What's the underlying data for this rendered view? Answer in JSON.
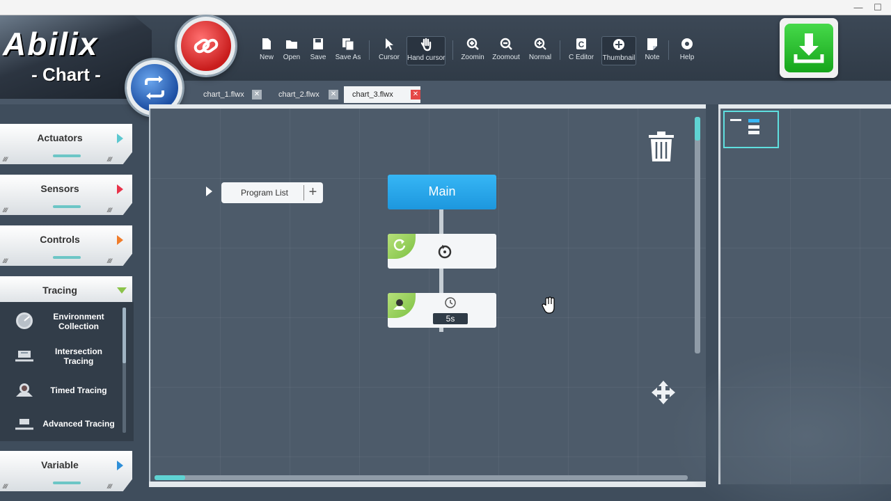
{
  "window": {
    "minimize": "—",
    "maximize": "☐"
  },
  "logo": {
    "top": "Abilix",
    "bottom": "- Chart -"
  },
  "toolbar": {
    "tools": [
      {
        "id": "new",
        "label": "New"
      },
      {
        "id": "open",
        "label": "Open"
      },
      {
        "id": "save",
        "label": "Save"
      },
      {
        "id": "save_as",
        "label": "Save As"
      },
      {
        "id": "cursor",
        "label": "Cursor"
      },
      {
        "id": "hand_cursor",
        "label": "Hand cursor",
        "active": true
      },
      {
        "id": "zoomin",
        "label": "Zoomin"
      },
      {
        "id": "zoomout",
        "label": "Zoomout"
      },
      {
        "id": "normal",
        "label": "Normal"
      },
      {
        "id": "c_editor",
        "label": "C Editor"
      },
      {
        "id": "thumbnail",
        "label": "Thumbnail",
        "active": true
      },
      {
        "id": "note",
        "label": "Note"
      },
      {
        "id": "help",
        "label": "Help"
      }
    ]
  },
  "tabs": [
    {
      "label": "chart_1.flwx",
      "close": "✕"
    },
    {
      "label": "chart_2.flwx",
      "close": "✕"
    },
    {
      "label": "chart_3.flwx",
      "close": "✕",
      "active": true
    }
  ],
  "sidebar": {
    "categories": [
      {
        "label": "Actuators",
        "arrow_color": "#5cc8d0"
      },
      {
        "label": "Sensors",
        "arrow_color": "#e8334a"
      },
      {
        "label": "Controls",
        "arrow_color": "#f07c2a"
      },
      {
        "label": "Tracing",
        "arrow_color": "#8bc34a",
        "expanded": true
      },
      {
        "label": "Variable",
        "arrow_color": "#2f8fd8"
      }
    ],
    "tracing_items": [
      {
        "label": "Environment Collection",
        "icon": "gauge-icon"
      },
      {
        "label": "Intersection Tracing",
        "icon": "intersection-icon"
      },
      {
        "label": "Timed Tracing",
        "icon": "timed-tracing-icon"
      },
      {
        "label": "Advanced Tracing",
        "icon": "advanced-tracing-icon"
      }
    ],
    "hatch": "////"
  },
  "canvas": {
    "program_list": {
      "label": "Program List",
      "plus": "+"
    },
    "main_block": {
      "label": "Main"
    },
    "blocks": [
      {
        "type": "loop",
        "icon": "loop-icon"
      },
      {
        "type": "timed-tracing",
        "icon": "timed-tracing-icon",
        "value": "5s"
      }
    ]
  },
  "colors": {
    "accent_cyan": "#5fd3d3",
    "main_blue": "#1d97de",
    "download_green": "#16a51b",
    "tab_close_red": "#e54848"
  }
}
